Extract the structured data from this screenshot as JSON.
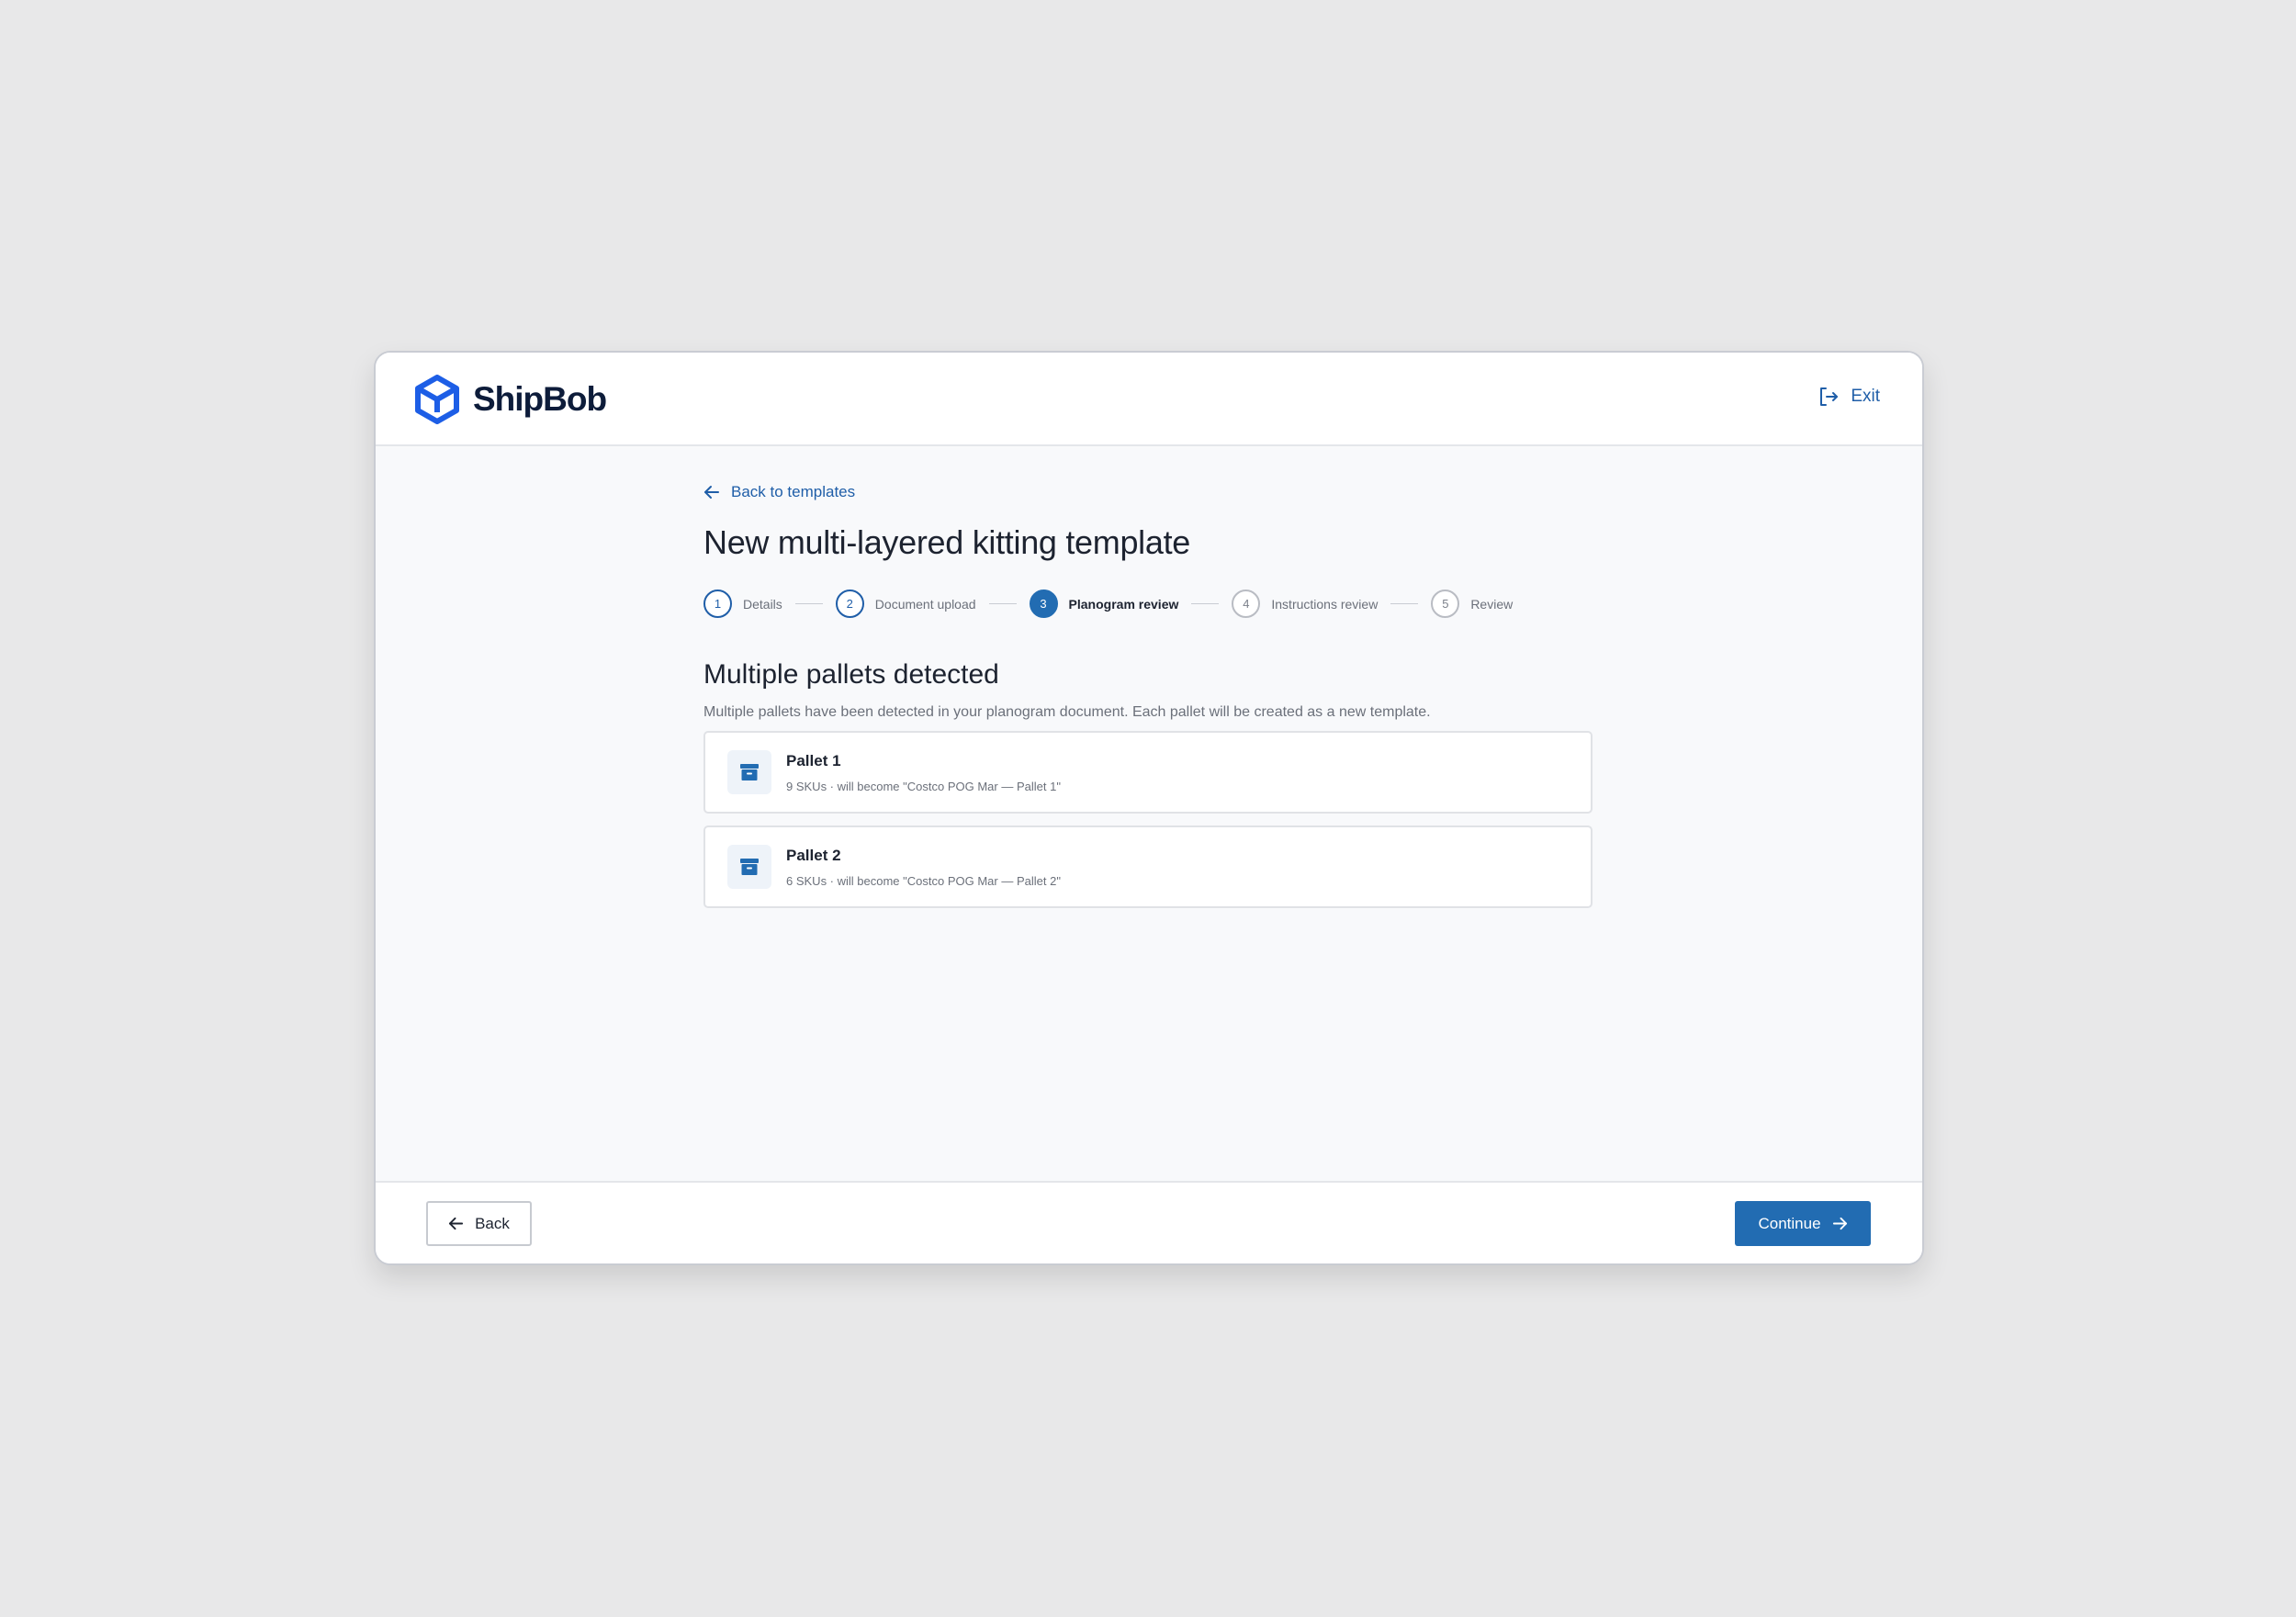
{
  "app": {
    "brand": "ShipBob",
    "exit_label": "Exit",
    "accent_color": "#226cb2",
    "logo_color": "#1d5ee6"
  },
  "page": {
    "back_link": "Back to templates",
    "title": "New multi-layered kitting template"
  },
  "stepper": {
    "steps": [
      {
        "number": "1",
        "label": "Details",
        "state": "complete"
      },
      {
        "number": "2",
        "label": "Document upload",
        "state": "complete"
      },
      {
        "number": "3",
        "label": "Planogram review",
        "state": "active"
      },
      {
        "number": "4",
        "label": "Instructions review",
        "state": "pending"
      },
      {
        "number": "5",
        "label": "Review",
        "state": "pending"
      }
    ]
  },
  "section": {
    "title": "Multiple pallets detected",
    "description": "Multiple pallets have been detected in your planogram document. Each pallet will be created as a new template."
  },
  "pallets": [
    {
      "name": "Pallet 1",
      "meta": "9 SKUs · will become \"Costco POG Mar — Pallet 1\"",
      "icon": "archive-box-icon"
    },
    {
      "name": "Pallet 2",
      "meta": "6 SKUs · will become \"Costco POG Mar — Pallet 2\"",
      "icon": "archive-box-icon"
    }
  ],
  "footer": {
    "back_label": "Back",
    "continue_label": "Continue"
  }
}
